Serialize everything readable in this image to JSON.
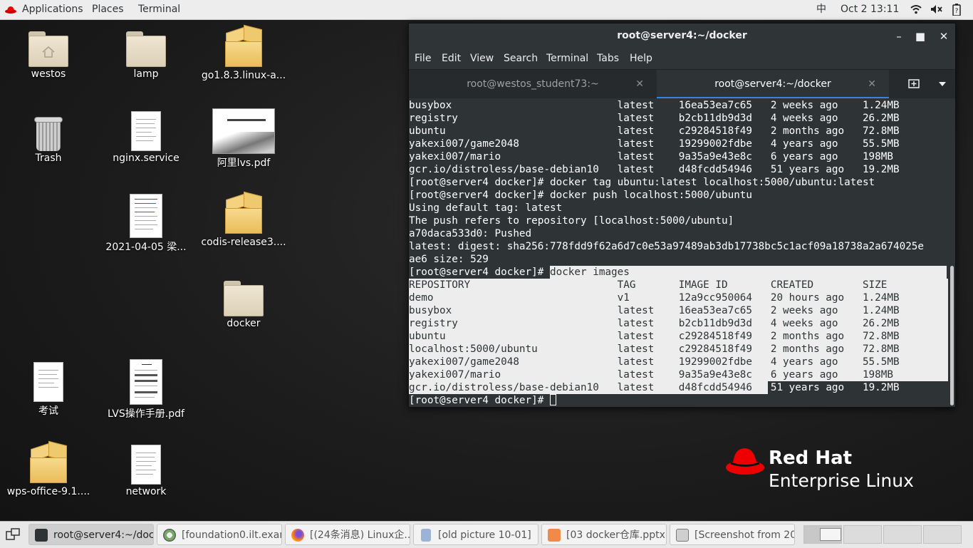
{
  "topbar": {
    "applications": "Applications",
    "places": "Places",
    "terminal": "Terminal",
    "input_method": "中",
    "datetime": "Oct 2  13:11"
  },
  "desktop_icons": [
    {
      "label": "westos"
    },
    {
      "label": "lamp"
    },
    {
      "label": "go1.8.3.linux-a..."
    },
    {
      "label": "Trash"
    },
    {
      "label": "nginx.service"
    },
    {
      "label": "阿里lvs.pdf"
    },
    {
      "label": "2021-04-05  梁..."
    },
    {
      "label": "codis-release3...."
    },
    {
      "label": "docker"
    },
    {
      "label": "考试"
    },
    {
      "label": "LVS操作手册.pdf"
    },
    {
      "label": "wps-office-9.1...."
    },
    {
      "label": "network"
    }
  ],
  "terminal": {
    "title": "root@server4:~/docker",
    "menu": [
      "File",
      "Edit",
      "View",
      "Search",
      "Terminal",
      "Tabs",
      "Help"
    ],
    "tabs": [
      {
        "label": "root@westos_student73:~"
      },
      {
        "label": "root@server4:~/docker"
      }
    ],
    "lines": [
      "busybox                           latest    16ea53ea7c65   2 weeks ago    1.24MB",
      "registry                          latest    b2cb11db9d3d   4 weeks ago    26.2MB",
      "ubuntu                            latest    c29284518f49   2 months ago   72.8MB",
      "yakexi007/game2048                latest    19299002fdbe   4 years ago    55.5MB",
      "yakexi007/mario                   latest    9a35a9e43e8c   6 years ago    198MB",
      "gcr.io/distroless/base-debian10   latest    d48fcdd54946   51 years ago   19.2MB",
      "[root@server4 docker]# docker tag ubuntu:latest localhost:5000/ubuntu:latest",
      "[root@server4 docker]# docker push localhost:5000/ubuntu",
      "Using default tag: latest",
      "The push refers to repository [localhost:5000/ubuntu]",
      "a70daca533d0: Pushed",
      "latest: digest: sha256:778fdd9f62a6d7c0e53a97489ab3db17738bc5c1acf09a18738a2a674025e",
      "ae6 size: 529",
      "[root@server4 docker]# docker images",
      "REPOSITORY                        TAG       IMAGE ID       CREATED        SIZE",
      "demo                              v1        12a9cc950064   20 hours ago   1.24MB",
      "busybox                           latest    16ea53ea7c65   2 weeks ago    1.24MB",
      "registry                          latest    b2cb11db9d3d   4 weeks ago    26.2MB",
      "ubuntu                            latest    c29284518f49   2 months ago   72.8MB",
      "localhost:5000/ubuntu             latest    c29284518f49   2 months ago   72.8MB",
      "yakexi007/game2048                latest    19299002fdbe   4 years ago    55.5MB",
      "yakexi007/mario                   latest    9a35a9e43e8c   6 years ago    198MB",
      "gcr.io/distroless/base-debian10   latest    d48fcdd54946   51 years ago   19.2MB",
      "[root@server4 docker]# "
    ]
  },
  "branding": {
    "line1": "Red Hat",
    "line2": "Enterprise Linux"
  },
  "taskbar": [
    {
      "label": "root@server4:~/doc...",
      "icon": "terminal-icon"
    },
    {
      "label": "[foundation0.ilt.exam...",
      "icon": "remote-viewer-icon"
    },
    {
      "label": "[(24条消息) Linux企...",
      "icon": "firefox-icon"
    },
    {
      "label": "[old picture  10-01]",
      "icon": "document-icon"
    },
    {
      "label": "[03 docker仓库.pptx ...",
      "icon": "presentation-icon"
    },
    {
      "label": "[Screenshot from 20...",
      "icon": "image-viewer-icon"
    }
  ]
}
